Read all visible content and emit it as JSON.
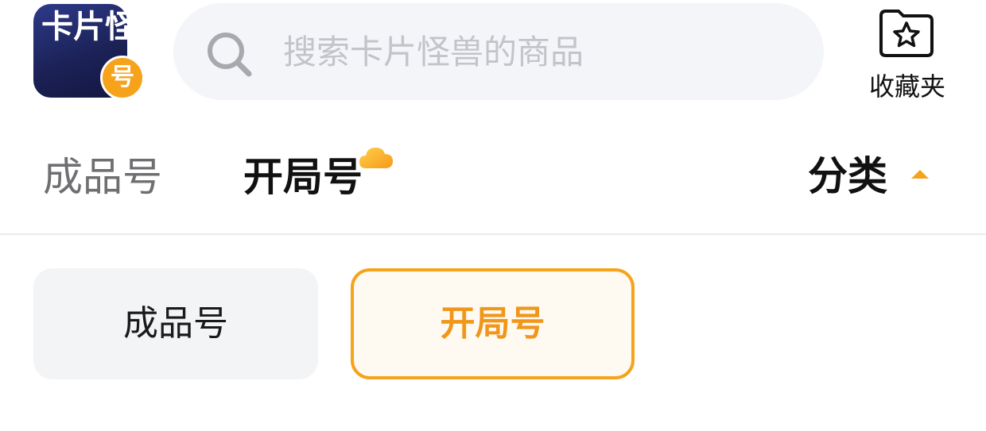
{
  "app": {
    "logo_text": "卡片怪兽",
    "logo_badge_text": "号"
  },
  "search": {
    "placeholder": "搜索卡片怪兽的商品",
    "value": ""
  },
  "favorites": {
    "label": "收藏夹",
    "icon": "star-folder-icon"
  },
  "tabs": [
    {
      "label": "成品号",
      "active": false
    },
    {
      "label": "开局号",
      "active": true
    }
  ],
  "category": {
    "label": "分类",
    "icon": "caret-up-icon"
  },
  "options": [
    {
      "label": "成品号",
      "selected": false
    },
    {
      "label": "开局号",
      "selected": true
    }
  ],
  "colors": {
    "accent": "#f5a31a",
    "logo_bg": "#1c2257",
    "search_bg": "#f4f5f9",
    "chip_bg": "#f3f4f6"
  }
}
